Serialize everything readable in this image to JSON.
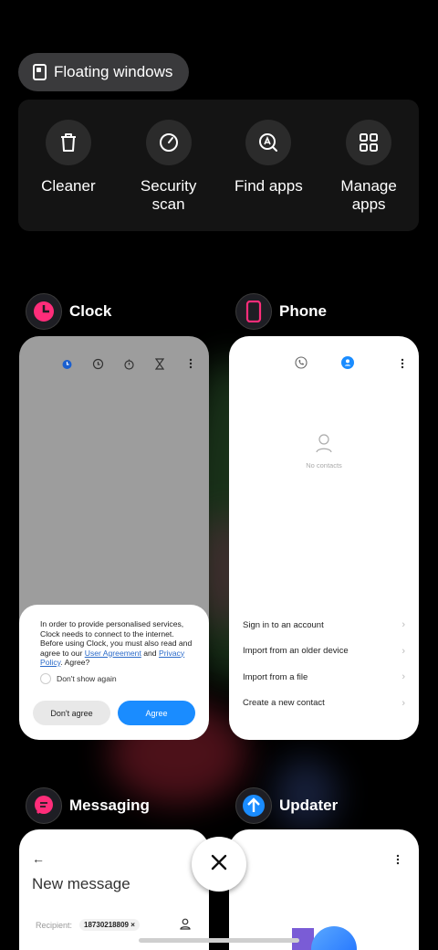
{
  "floating_windows": {
    "label": "Floating windows"
  },
  "quick_actions": [
    {
      "label": "Cleaner",
      "icon": "trash-icon"
    },
    {
      "label": "Security\nscan",
      "icon": "gauge-icon"
    },
    {
      "label": "Find apps",
      "icon": "find-apps-icon"
    },
    {
      "label": "Manage\napps",
      "icon": "grid-icon"
    }
  ],
  "apps": {
    "clock": {
      "name": "Clock",
      "dialog": {
        "text_before": "In order to provide personalised services, Clock needs to connect to the internet. Before using Clock, you must also read and agree to our ",
        "user_agreement": "User Agreement",
        "and": " and ",
        "privacy_policy": "Privacy Policy",
        "text_after": ". Agree?",
        "checkbox_label": "Don't show again",
        "disagree": "Don't agree",
        "agree": "Agree"
      }
    },
    "phone": {
      "name": "Phone",
      "empty_text": "No contacts",
      "list": [
        "Sign in to an account",
        "Import from an older device",
        "Import from a file",
        "Create a new contact"
      ]
    },
    "messaging": {
      "name": "Messaging",
      "title": "New message",
      "recipient_label": "Recipient:",
      "recipient_value": "18730218809"
    },
    "updater": {
      "name": "Updater"
    }
  },
  "colors": {
    "accent": "#1a8cff",
    "clock_pink": "#ff2d7a"
  }
}
